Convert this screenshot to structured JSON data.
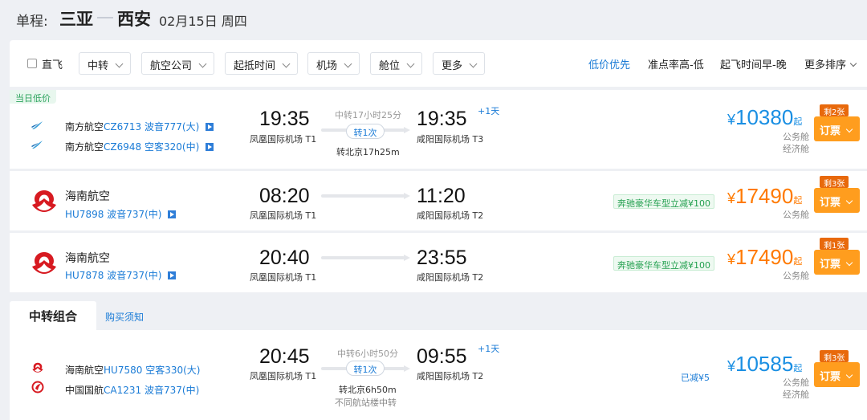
{
  "header": {
    "trip_type": "单程:",
    "from": "三亚",
    "to": "西安",
    "date": "02月15日 周四"
  },
  "filters": {
    "nonstop": "直飞",
    "dropdowns": [
      "中转",
      "航空公司",
      "起抵时间",
      "机场",
      "舱位",
      "更多"
    ],
    "sorts": [
      "低价优先",
      "准点率高-低",
      "起飞时间早-晚",
      "更多排序"
    ]
  },
  "flights": [
    {
      "tag": "当日低价",
      "legs": [
        {
          "airline": "南方航空",
          "flight": "CZ6713",
          "plane": "波音777(大)"
        },
        {
          "airline": "南方航空",
          "flight": "CZ6948",
          "plane": "空客320(中)"
        }
      ],
      "dep_time": "19:35",
      "dep_airport": "凤凰国际机场 T1",
      "arr_time": "19:35",
      "arr_airport": "咸阳国际机场 T3",
      "next_day": "+1天",
      "duration": "中转17小时25分",
      "stops": "转1次",
      "transfer": "转北京17h25m",
      "currency": "¥",
      "price": "10380",
      "price_suffix": "起",
      "cabins": [
        "公务舱",
        "经济舱"
      ],
      "remaining": "剩2张",
      "book": "订票"
    },
    {
      "airline": "海南航空",
      "flight": "HU7898",
      "plane": "波音737(中)",
      "dep_time": "08:20",
      "dep_airport": "凤凰国际机场 T1",
      "arr_time": "11:20",
      "arr_airport": "咸阳国际机场 T2",
      "promo": "奔驰豪华车型立减¥100",
      "currency": "¥",
      "price": "17490",
      "price_suffix": "起",
      "cabins": [
        "公务舱"
      ],
      "remaining": "剩3张",
      "book": "订票"
    },
    {
      "airline": "海南航空",
      "flight": "HU7878",
      "plane": "波音737(中)",
      "dep_time": "20:40",
      "dep_airport": "凤凰国际机场 T1",
      "arr_time": "23:55",
      "arr_airport": "咸阳国际机场 T2",
      "promo": "奔驰豪华车型立减¥100",
      "currency": "¥",
      "price": "17490",
      "price_suffix": "起",
      "cabins": [
        "公务舱"
      ],
      "remaining": "剩1张",
      "book": "订票"
    }
  ],
  "combo_section": {
    "tab": "中转组合",
    "notice": "购买须知"
  },
  "combo": {
    "legs": [
      {
        "airline": "海南航空",
        "flight": "HU7580",
        "plane": "空客330(大)"
      },
      {
        "airline": "中国国航",
        "flight": "CA1231",
        "plane": "波音737(中)"
      }
    ],
    "dep_time": "20:45",
    "dep_airport": "凤凰国际机场 T1",
    "arr_time": "09:55",
    "arr_airport": "咸阳国际机场 T2",
    "next_day": "+1天",
    "duration": "中转6小时50分",
    "stops": "转1次",
    "transfer": "转北京6h50m",
    "transfer_note": "不同航站楼中转",
    "discount": "已减¥5",
    "currency": "¥",
    "price": "10585",
    "price_suffix": "起",
    "cabins": [
      "公务舱",
      "经济舱"
    ],
    "remaining": "剩3张",
    "book": "订票"
  },
  "colors": {
    "accent_blue": "#1a7bd6",
    "price_orange": "#ff7a00",
    "book_button": "#ff9d1e",
    "promo_green": "#23a04f"
  }
}
